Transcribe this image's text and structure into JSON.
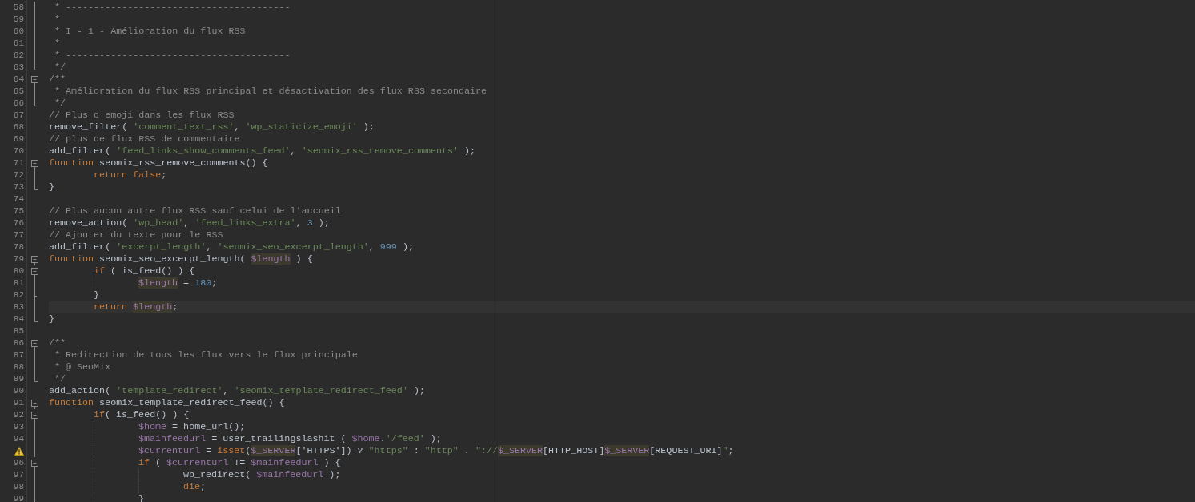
{
  "editor": {
    "lines": [
      {
        "number": "58",
        "kind": "fold-body",
        "warning": false,
        "current": false,
        "tokens": [
          {
            "kind": "comment",
            "text": " * ----------------------------------------"
          }
        ]
      },
      {
        "number": "59",
        "kind": "fold-body",
        "warning": false,
        "current": false,
        "tokens": [
          {
            "kind": "comment",
            "text": " *"
          }
        ]
      },
      {
        "number": "60",
        "kind": "fold-body",
        "warning": false,
        "current": false,
        "tokens": [
          {
            "kind": "comment",
            "text": " * I - 1 - Amélioration du flux RSS"
          }
        ]
      },
      {
        "number": "61",
        "kind": "fold-body",
        "warning": false,
        "current": false,
        "tokens": [
          {
            "kind": "comment",
            "text": " *"
          }
        ]
      },
      {
        "number": "62",
        "kind": "fold-body",
        "warning": false,
        "current": false,
        "tokens": [
          {
            "kind": "comment",
            "text": " * ----------------------------------------"
          }
        ]
      },
      {
        "number": "63",
        "kind": "fold-end",
        "warning": false,
        "current": false,
        "tokens": [
          {
            "kind": "comment",
            "text": " */"
          }
        ]
      },
      {
        "number": "64",
        "kind": "fold-start",
        "warning": false,
        "current": false,
        "tokens": [
          {
            "kind": "comment",
            "text": "/**"
          }
        ]
      },
      {
        "number": "65",
        "kind": "fold-body",
        "warning": false,
        "current": false,
        "tokens": [
          {
            "kind": "comment",
            "text": " * Amélioration du flux RSS principal et désactivation des flux RSS secondaire"
          }
        ]
      },
      {
        "number": "66",
        "kind": "fold-end",
        "warning": false,
        "current": false,
        "tokens": [
          {
            "kind": "comment",
            "text": " */"
          }
        ]
      },
      {
        "number": "67",
        "kind": "plain",
        "warning": false,
        "current": false,
        "tokens": [
          {
            "kind": "comment",
            "text": "// Plus d'emoji dans les flux RSS"
          }
        ]
      },
      {
        "number": "68",
        "kind": "plain",
        "warning": false,
        "current": false,
        "tokens": [
          {
            "kind": "plain",
            "text": "remove_filter( "
          },
          {
            "kind": "string",
            "text": "'comment_text_rss'"
          },
          {
            "kind": "plain",
            "text": ", "
          },
          {
            "kind": "string",
            "text": "'wp_staticize_emoji'"
          },
          {
            "kind": "plain",
            "text": " );"
          }
        ]
      },
      {
        "number": "69",
        "kind": "plain",
        "warning": false,
        "current": false,
        "tokens": [
          {
            "kind": "comment",
            "text": "// plus de flux RSS de commentaire"
          }
        ]
      },
      {
        "number": "70",
        "kind": "plain",
        "warning": false,
        "current": false,
        "tokens": [
          {
            "kind": "plain",
            "text": "add_filter( "
          },
          {
            "kind": "string",
            "text": "'feed_links_show_comments_feed'"
          },
          {
            "kind": "plain",
            "text": ", "
          },
          {
            "kind": "string",
            "text": "'seomix_rss_remove_comments'"
          },
          {
            "kind": "plain",
            "text": " );"
          }
        ]
      },
      {
        "number": "71",
        "kind": "fold-start",
        "warning": false,
        "current": false,
        "tokens": [
          {
            "kind": "keyword",
            "text": "function"
          },
          {
            "kind": "plain",
            "text": " seomix_rss_remove_comments() {"
          }
        ]
      },
      {
        "number": "72",
        "kind": "fold-body",
        "warning": false,
        "current": false,
        "tokens": [
          {
            "kind": "keyword",
            "text": "\treturn false"
          },
          {
            "kind": "plain",
            "text": ";"
          }
        ]
      },
      {
        "number": "73",
        "kind": "fold-end",
        "warning": false,
        "current": false,
        "tokens": [
          {
            "kind": "plain",
            "text": "}"
          }
        ]
      },
      {
        "number": "74",
        "kind": "plain",
        "warning": false,
        "current": false
      },
      {
        "number": "75",
        "kind": "plain",
        "warning": false,
        "current": false,
        "tokens": [
          {
            "kind": "comment",
            "text": "// Plus aucun autre flux RSS sauf celui de l'accueil"
          }
        ]
      },
      {
        "number": "76",
        "kind": "plain",
        "warning": false,
        "current": false,
        "tokens": [
          {
            "kind": "plain",
            "text": "remove_action( "
          },
          {
            "kind": "string",
            "text": "'wp_head'"
          },
          {
            "kind": "plain",
            "text": ", "
          },
          {
            "kind": "string",
            "text": "'feed_links_extra'"
          },
          {
            "kind": "plain",
            "text": ", "
          },
          {
            "kind": "number",
            "text": "3"
          },
          {
            "kind": "plain",
            "text": " );"
          }
        ]
      },
      {
        "number": "77",
        "kind": "plain",
        "warning": false,
        "current": false,
        "tokens": [
          {
            "kind": "comment",
            "text": "// Ajouter du texte pour le RSS"
          }
        ]
      },
      {
        "number": "78",
        "kind": "plain",
        "warning": false,
        "current": false,
        "tokens": [
          {
            "kind": "plain",
            "text": "add_filter( "
          },
          {
            "kind": "string",
            "text": "'excerpt_length'"
          },
          {
            "kind": "plain",
            "text": ", "
          },
          {
            "kind": "string",
            "text": "'seomix_seo_excerpt_length'"
          },
          {
            "kind": "plain",
            "text": ", "
          },
          {
            "kind": "number",
            "text": "999"
          },
          {
            "kind": "plain",
            "text": " );"
          }
        ]
      },
      {
        "number": "79",
        "kind": "fold-start",
        "warning": false,
        "current": false,
        "tokens": [
          {
            "kind": "keyword",
            "text": "function"
          },
          {
            "kind": "plain",
            "text": " seomix_seo_excerpt_length( "
          },
          {
            "kind": "variable-match",
            "text": "$length"
          },
          {
            "kind": "plain",
            "text": " ) {"
          }
        ]
      },
      {
        "number": "80",
        "kind": "fold-start",
        "warning": false,
        "current": false,
        "tokens": [
          {
            "kind": "keyword",
            "text": "\tif"
          },
          {
            "kind": "plain",
            "text": " ( is_feed() ) {"
          }
        ]
      },
      {
        "number": "81",
        "kind": "fold-body",
        "warning": false,
        "current": false,
        "tokens": [
          {
            "kind": "variable-match",
            "text": "\t\t$length"
          },
          {
            "kind": "plain",
            "text": " = "
          },
          {
            "kind": "number",
            "text": "180"
          },
          {
            "kind": "plain",
            "text": ";"
          }
        ]
      },
      {
        "number": "82",
        "kind": "fold-inner-end",
        "warning": false,
        "current": false,
        "tokens": [
          {
            "kind": "plain",
            "text": "\t}"
          }
        ]
      },
      {
        "number": "83",
        "kind": "fold-body",
        "warning": false,
        "current": true,
        "tokens": [
          {
            "kind": "keyword",
            "text": "\treturn "
          },
          {
            "kind": "variable-match",
            "text": "$length"
          },
          {
            "kind": "plain",
            "text": ";"
          }
        ]
      },
      {
        "number": "84",
        "kind": "fold-end",
        "warning": false,
        "current": false,
        "tokens": [
          {
            "kind": "plain",
            "text": "}"
          }
        ]
      },
      {
        "number": "85",
        "kind": "plain",
        "warning": false,
        "current": false
      },
      {
        "number": "86",
        "kind": "fold-start",
        "warning": false,
        "current": false,
        "tokens": [
          {
            "kind": "comment",
            "text": "/**"
          }
        ]
      },
      {
        "number": "87",
        "kind": "fold-body",
        "warning": false,
        "current": false,
        "tokens": [
          {
            "kind": "comment",
            "text": " * Redirection de tous les flux vers le flux principale"
          }
        ]
      },
      {
        "number": "88",
        "kind": "fold-body",
        "warning": false,
        "current": false,
        "tokens": [
          {
            "kind": "comment",
            "text": " * @ SeoMix"
          }
        ]
      },
      {
        "number": "89",
        "kind": "fold-end",
        "warning": false,
        "current": false,
        "tokens": [
          {
            "kind": "comment",
            "text": " */"
          }
        ]
      },
      {
        "number": "90",
        "kind": "plain",
        "warning": false,
        "current": false,
        "tokens": [
          {
            "kind": "plain",
            "text": "add_action( "
          },
          {
            "kind": "string",
            "text": "'template_redirect'"
          },
          {
            "kind": "plain",
            "text": ", "
          },
          {
            "kind": "string",
            "text": "'seomix_template_redirect_feed'"
          },
          {
            "kind": "plain",
            "text": " );"
          }
        ]
      },
      {
        "number": "91",
        "kind": "fold-start",
        "warning": false,
        "current": false,
        "tokens": [
          {
            "kind": "keyword",
            "text": "function"
          },
          {
            "kind": "plain",
            "text": " seomix_template_redirect_feed() {"
          }
        ]
      },
      {
        "number": "92",
        "kind": "fold-start",
        "warning": false,
        "current": false,
        "tokens": [
          {
            "kind": "keyword",
            "text": "\tif"
          },
          {
            "kind": "plain",
            "text": "( is_feed() ) {"
          }
        ]
      },
      {
        "number": "93",
        "kind": "fold-body",
        "warning": false,
        "current": false,
        "tokens": [
          {
            "kind": "variable",
            "text": "\t\t$home"
          },
          {
            "kind": "plain",
            "text": " = home_url();"
          }
        ]
      },
      {
        "number": "94",
        "kind": "fold-body",
        "warning": false,
        "current": false,
        "tokens": [
          {
            "kind": "variable",
            "text": "\t\t$mainfeedurl"
          },
          {
            "kind": "plain",
            "text": " = user_trailingslashit ( "
          },
          {
            "kind": "variable",
            "text": "$home"
          },
          {
            "kind": "plain",
            "text": "."
          },
          {
            "kind": "string",
            "text": "'/feed'"
          },
          {
            "kind": "plain",
            "text": " );"
          }
        ]
      },
      {
        "kind": "fold-body",
        "warning": true,
        "current": false,
        "tokens": [
          {
            "kind": "variable",
            "text": "\t\t$currenturl"
          },
          {
            "kind": "plain",
            "text": " = "
          },
          {
            "kind": "keyword",
            "text": "isset"
          },
          {
            "kind": "plain",
            "text": "("
          },
          {
            "kind": "variable-match",
            "text": "$_SERVER"
          },
          {
            "kind": "plain",
            "text": "['HTTPS']) ? "
          },
          {
            "kind": "string",
            "text": "\"https\""
          },
          {
            "kind": "plain",
            "text": " : "
          },
          {
            "kind": "string",
            "text": "\"http\""
          },
          {
            "kind": "plain",
            "text": " . "
          },
          {
            "kind": "string",
            "text": "\"://"
          },
          {
            "kind": "variable-match",
            "text": "$_SERVER"
          },
          {
            "kind": "plain",
            "text": "[HTTP_HOST]"
          },
          {
            "kind": "variable-match",
            "text": "$_SERVER"
          },
          {
            "kind": "plain",
            "text": "[REQUEST_URI]"
          },
          {
            "kind": "string",
            "text": "\""
          },
          {
            "kind": "plain",
            "text": ";"
          }
        ]
      },
      {
        "number": "96",
        "kind": "fold-start",
        "warning": false,
        "current": false,
        "tokens": [
          {
            "kind": "keyword",
            "text": "\t\tif"
          },
          {
            "kind": "plain",
            "text": " ( "
          },
          {
            "kind": "variable",
            "text": "$currenturl"
          },
          {
            "kind": "plain",
            "text": " != "
          },
          {
            "kind": "variable",
            "text": "$mainfeedurl"
          },
          {
            "kind": "plain",
            "text": " ) {"
          }
        ]
      },
      {
        "number": "97",
        "kind": "fold-body",
        "warning": false,
        "current": false,
        "tokens": [
          {
            "kind": "plain",
            "text": "\t\t\twp_redirect( "
          },
          {
            "kind": "variable",
            "text": "$mainfeedurl"
          },
          {
            "kind": "plain",
            "text": " );"
          }
        ]
      },
      {
        "number": "98",
        "kind": "fold-body",
        "warning": false,
        "current": false,
        "tokens": [
          {
            "kind": "keyword",
            "text": "\t\t\tdie"
          },
          {
            "kind": "plain",
            "text": ";"
          }
        ]
      },
      {
        "number": "99",
        "kind": "fold-inner-end",
        "warning": false,
        "current": false,
        "tokens": [
          {
            "kind": "plain",
            "text": "\t\t}"
          }
        ]
      }
    ]
  }
}
